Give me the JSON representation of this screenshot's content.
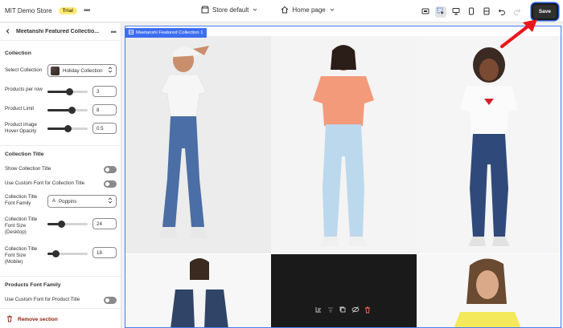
{
  "topbar": {
    "store_name": "MIT Demo Store",
    "badge": "Trial",
    "theme": "Store default",
    "page": "Home page",
    "save_label": "Save"
  },
  "sidebar": {
    "title": "Meetanshi Featured Collectio...",
    "collection_heading": "Collection",
    "select_collection_label": "Select Collection",
    "select_collection_value": "Holiday Collection",
    "products_per_row_label": "Products per row",
    "products_per_row_value": "3",
    "products_per_row_level": 0.55,
    "product_limit_label": "Product Limit",
    "product_limit_value": "8",
    "product_limit_level": 0.6,
    "hover_opacity_label_1": "Product image",
    "hover_opacity_label_2": "Hover Opacity",
    "hover_opacity_value": "0.5",
    "hover_opacity_level": 0.5,
    "collection_title_heading": "Collection Title",
    "show_title_label": "Show Collection Title",
    "custom_font_label": "Use Custom Font for Collection Title",
    "font_family_label_1": "Collection Title",
    "font_family_label_2": "Font Family",
    "font_family_value": "Poppins",
    "font_size_desktop_label_1": "Collection Title",
    "font_size_desktop_label_2": "Font Size",
    "font_size_desktop_label_3": "(Desktop)",
    "font_size_desktop_value": "24",
    "font_size_desktop_level": 0.35,
    "font_size_mobile_label_1": "Collection Title",
    "font_size_mobile_label_2": "Font Size",
    "font_size_mobile_label_3": "(Mobile)",
    "font_size_mobile_value": "18",
    "font_size_mobile_level": 0.2,
    "products_font_heading": "Products Font Family",
    "custom_font_product_label": "Use Custom Font for Product Title",
    "remove_label": "Remove section"
  },
  "preview": {
    "section_tag": "Meetanshi Featured Collection 1"
  },
  "colors": {
    "accent": "#3d6ef0",
    "save_bg": "#303030",
    "danger": "#8e1f0b",
    "arrow": "#e8161b"
  }
}
